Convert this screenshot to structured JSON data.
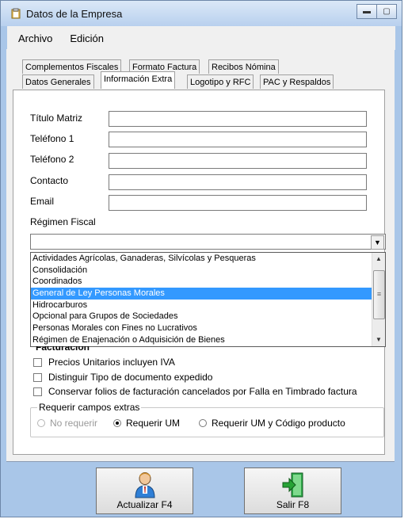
{
  "window": {
    "title": "Datos de la Empresa"
  },
  "menu": [
    "Archivo",
    "Edición"
  ],
  "tabs_row1": [
    "Complementos Fiscales",
    "Formato Factura",
    "Recibos Nómina"
  ],
  "tabs_row2": [
    "Datos Generales",
    "Información Extra",
    "Logotipo y RFC",
    "PAC y Respaldos"
  ],
  "active_tab": "Información Extra",
  "fields": {
    "titulo_matriz": {
      "label": "Título Matriz",
      "value": ""
    },
    "telefono1": {
      "label": "Teléfono 1",
      "value": ""
    },
    "telefono2": {
      "label": "Teléfono 2",
      "value": ""
    },
    "contacto": {
      "label": "Contacto",
      "value": ""
    },
    "email": {
      "label": "Email",
      "value": ""
    }
  },
  "regimen": {
    "label": "Régimen Fiscal",
    "value": "",
    "options": [
      "Actividades Agrícolas, Ganaderas, Silvícolas y Pesqueras",
      "Consolidación",
      "Coordinados",
      "General de Ley Personas Morales",
      "Hidrocarburos",
      "Opcional para Grupos de Sociedades",
      "Personas Morales con Fines no Lucrativos",
      "Régimen de Enajenación o Adquisición de Bienes"
    ],
    "highlighted": "General de Ley Personas Morales"
  },
  "facturacion": {
    "title": "Facturación",
    "checks": [
      {
        "label": "Precios Unitarios incluyen IVA",
        "checked": false
      },
      {
        "label": "Distinguir Tipo de documento expedido",
        "checked": false
      },
      {
        "label": "Conservar folios de facturación cancelados por Falla en Timbrado factura",
        "checked": false
      }
    ]
  },
  "requerir": {
    "title": "Requerir campos extras",
    "options": [
      {
        "label": "No requerir",
        "selected": false,
        "enabled": false
      },
      {
        "label": "Requerir UM",
        "selected": true,
        "enabled": true
      },
      {
        "label": "Requerir UM y Código producto",
        "selected": false,
        "enabled": true
      }
    ]
  },
  "buttons": {
    "update": "Actualizar F4",
    "exit": "Salir F8"
  }
}
